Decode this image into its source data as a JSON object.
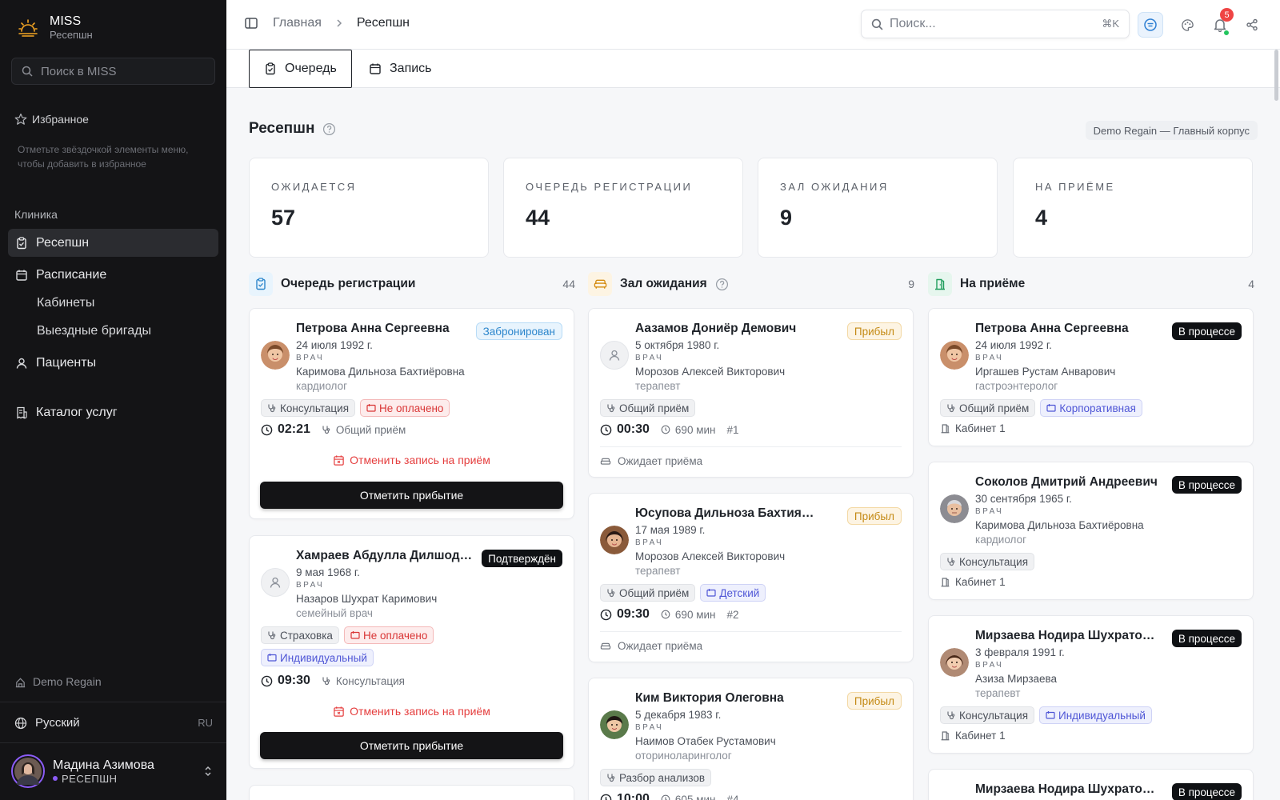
{
  "app": {
    "name": "MISS",
    "subtitle": "Ресепшн"
  },
  "sidebar": {
    "search_placeholder": "Поиск в MISS",
    "favorites_title": "Избранное",
    "favorites_hint": "Отметьте звёздочкой элементы меню, чтобы добавить в избранное",
    "section": "Клиника",
    "items": [
      {
        "label": "Ресепшн"
      },
      {
        "label": "Расписание"
      },
      {
        "label": "Кабинеты"
      },
      {
        "label": "Выездные бригады"
      },
      {
        "label": "Пациенты"
      },
      {
        "label": "Каталог услуг"
      }
    ],
    "org": "Demo Regain",
    "language": {
      "label": "Русский",
      "code": "RU"
    },
    "user": {
      "name": "Мадина Азимова",
      "role": "РЕСЕПШН"
    }
  },
  "topbar": {
    "breadcrumb_home": "Главная",
    "breadcrumb_current": "Ресепшн",
    "search_placeholder": "Поиск...",
    "search_shortcut": "⌘K",
    "notifications_count": "5"
  },
  "tabs": [
    {
      "label": "Очередь"
    },
    {
      "label": "Запись"
    }
  ],
  "page": {
    "title": "Ресепшн",
    "org_pill": "Demo Regain — Главный корпус"
  },
  "stats": [
    {
      "label": "ОЖИДАЕТСЯ",
      "value": "57"
    },
    {
      "label": "ОЧЕРЕДЬ РЕГИСТРАЦИИ",
      "value": "44"
    },
    {
      "label": "ЗАЛ ОЖИДАНИЯ",
      "value": "9"
    },
    {
      "label": "НА ПРИЁМЕ",
      "value": "4"
    }
  ],
  "columns": [
    {
      "title": "Очередь регистрации",
      "count": "44"
    },
    {
      "title": "Зал ожидания",
      "count": "9"
    },
    {
      "title": "На приёме",
      "count": "4"
    }
  ],
  "labels": {
    "doctor_role": "ВРАЧ",
    "cancel": "Отменить запись на приём",
    "arrive": "Отметить прибытие",
    "waiting": "Ожидает приёма"
  },
  "registration": [
    {
      "name": "Петрова Анна Сергеевна",
      "dob": "24 июля 1992 г.",
      "doctor": "Каримова Дильноза Бахтиёровна",
      "spec": "кардиолог",
      "status": "Забронирован",
      "tags": [
        "Консультация",
        "Не оплачено"
      ],
      "time": "02:21",
      "service": "Общий приём"
    },
    {
      "name": "Хамраев Абдулла Дилшодович",
      "dob": "9 мая 1968 г.",
      "doctor": "Назаров Шухрат Каримович",
      "spec": "семейный врач",
      "status": "Подтверждён",
      "tags": [
        "Страховка",
        "Не оплачено",
        "Индивидуальный"
      ],
      "time": "09:30",
      "service": "Консультация"
    }
  ],
  "waiting_room": [
    {
      "name": "Аазамов Дониёр Демович",
      "dob": "5 октября 1980 г.",
      "doctor": "Морозов Алексей Викторович",
      "spec": "терапевт",
      "status": "Прибыл",
      "tags": [
        "Общий приём"
      ],
      "time": "00:30",
      "duration": "690 мин",
      "num": "#1"
    },
    {
      "name": "Юсупова Дильноза Бахтияровна",
      "dob": "17 мая 1989 г.",
      "doctor": "Морозов Алексей Викторович",
      "spec": "терапевт",
      "status": "Прибыл",
      "tags": [
        "Общий приём",
        "Детский"
      ],
      "time": "09:30",
      "duration": "690 мин",
      "num": "#2"
    },
    {
      "name": "Ким Виктория Олеговна",
      "dob": "5 декабря 1983 г.",
      "doctor": "Наимов Отабек Рустамович",
      "spec": "оториноларинголог",
      "status": "Прибыл",
      "tags": [
        "Разбор анализов"
      ],
      "time": "10:00",
      "duration": "605 мин",
      "num": "#4"
    }
  ],
  "in_appointment": [
    {
      "name": "Петрова Анна Сергеевна",
      "dob": "24 июля 1992 г.",
      "doctor": "Иргашев Рустам Анварович",
      "spec": "гастроэнтеролог",
      "status": "В процессе",
      "tags": [
        "Общий приём",
        "Корпоративная"
      ],
      "room": "Кабинет 1"
    },
    {
      "name": "Соколов Дмитрий Андреевич",
      "dob": "30 сентября 1965 г.",
      "doctor": "Каримова Дильноза Бахтиёровна",
      "spec": "кардиолог",
      "status": "В процессе",
      "tags": [
        "Консультация"
      ],
      "room": "Кабинет 1"
    },
    {
      "name": "Мирзаева Нодира Шухратовна",
      "dob": "3 февраля 1991 г.",
      "doctor": "Азиза Мирзаева",
      "spec": "терапевт",
      "status": "В процессе",
      "tags": [
        "Консультация",
        "Индивидуальный"
      ],
      "room": "Кабинет 1"
    },
    {
      "name": "Мирзаева Нодира Шухратовна",
      "status": "В процессе"
    }
  ]
}
